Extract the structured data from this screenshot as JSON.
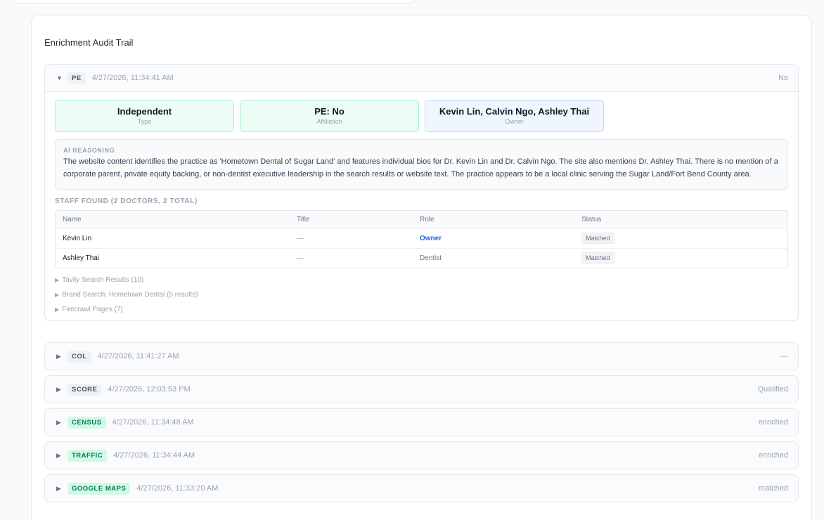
{
  "panel": {
    "title": "Enrichment Audit Trail"
  },
  "entries": [
    {
      "tag": "PE",
      "timestamp": "4/27/2026, 11:34:41 AM",
      "value": "No",
      "expanded": true
    },
    {
      "tag": "COL",
      "timestamp": "4/27/2026, 11:41:27 AM",
      "value": "—"
    },
    {
      "tag": "SCORE",
      "timestamp": "4/27/2026, 12:03:53 PM",
      "value": "Qualified"
    },
    {
      "tag": "CENSUS",
      "timestamp": "4/27/2026, 11:34:48 AM",
      "value": "enriched"
    },
    {
      "tag": "TRAFFIC",
      "timestamp": "4/27/2026, 11:34:44 AM",
      "value": "enriched"
    },
    {
      "tag": "GOOGLE MAPS",
      "timestamp": "4/27/2026, 11:33:20 AM",
      "value": "matched"
    }
  ],
  "pe": {
    "cards": [
      {
        "value": "Independent",
        "label": "Type"
      },
      {
        "value": "PE: No",
        "label": "Affiliation"
      },
      {
        "value": "Kevin Lin, Calvin Ngo, Ashley Thai",
        "label": "Owner"
      }
    ],
    "reasoning_label": "AI REASONING",
    "reasoning": "The website content identifies the practice as 'Hometown Dental of Sugar Land' and features individual bios for Dr. Kevin Lin and Dr. Calvin Ngo. The site also mentions Dr. Ashley Thai. There is no mention of a corporate parent, private equity backing, or non-dentist executive leadership in the search results or website text. The practice appears to be a local clinic serving the Sugar Land/Fort Bend County area.",
    "staff_label": "STAFF FOUND (2 DOCTORS, 2 TOTAL)",
    "columns": [
      "Name",
      "Title",
      "Role",
      "Status"
    ],
    "staff": [
      {
        "name": "Kevin Lin",
        "title": "—",
        "role": "Owner",
        "status": "Matched"
      },
      {
        "name": "Ashley Thai",
        "title": "—",
        "role": "Dentist",
        "status": "Matched"
      }
    ],
    "collapsibles": [
      "Tavily Search Results (10)",
      "Brand Search: Hometown Dental (5 results)",
      "Firecrawl Pages (7)"
    ]
  },
  "icons": {
    "expanded": "▼",
    "collapsed": "▶"
  }
}
